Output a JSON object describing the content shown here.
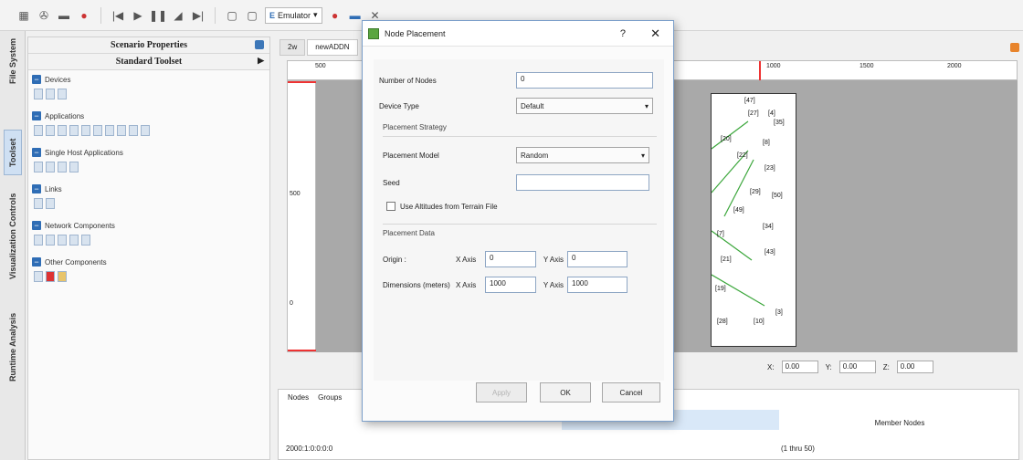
{
  "toolbar": {
    "simulator_label": "Emulator",
    "icons": [
      "grid-icon",
      "tools-icon",
      "clapper-icon",
      "pin-icon",
      "skip-back-icon",
      "play-icon",
      "pause-icon",
      "step-back-icon",
      "step-forward-icon",
      "window-icon",
      "window2-icon",
      "simulator-select",
      "record-icon",
      "stop-icon",
      "wrench-icon"
    ]
  },
  "vtabs": [
    "File System",
    "Toolset",
    "Visualization Controls",
    "Runtime Analysis"
  ],
  "left_panel": {
    "title": "Scenario Properties",
    "subtitle": "Standard Toolset",
    "groups": [
      {
        "label": "Devices",
        "icons": 3
      },
      {
        "label": "Applications",
        "icons": 10
      },
      {
        "label": "Single Host Applications",
        "icons": 4
      },
      {
        "label": "Links",
        "icons": 2
      },
      {
        "label": "Network Components",
        "icons": 5
      },
      {
        "label": "Other Components",
        "icons": 3
      }
    ]
  },
  "main": {
    "tabs": [
      "2w",
      "newADDN"
    ],
    "ruler_top": [
      "500",
      "1000",
      "1500",
      "2000"
    ],
    "ruler_left": [
      "500",
      "0"
    ],
    "node_labels": [
      "[47]",
      "[27]",
      "[4]",
      "[35]",
      "[20]",
      "[8]",
      "[22]",
      "[23]",
      "[29]",
      "[50]",
      "[7]",
      "[43]",
      "[21]",
      "[34]",
      "[3]",
      "[28]",
      "[10]",
      "[49]",
      "[19]"
    ],
    "coords": {
      "x_label": "X:",
      "x": "0.00",
      "y_label": "Y:",
      "y": "0.00",
      "z_label": "Z:",
      "z": "0.00"
    },
    "bottom_tabs": [
      "Nodes",
      "Groups"
    ],
    "table": {
      "header": "Member Nodes",
      "row_left": "2000:1:0:0:0:0",
      "row_right": "(1 thru 50)"
    }
  },
  "dialog": {
    "title": "Node Placement",
    "help": "?",
    "close": "✕",
    "number_of_nodes_label": "Number of Nodes",
    "number_of_nodes_value": "0",
    "device_type_label": "Device Type",
    "device_type_value": "Default",
    "placement_strategy_label": "Placement Strategy",
    "placement_model_label": "Placement Model",
    "placement_model_value": "Random",
    "seed_label": "Seed",
    "seed_value": "",
    "use_altitudes_label": "Use Altitudes from Terrain File",
    "placement_data_label": "Placement Data",
    "origin_label": "Origin :",
    "x_axis_label": "X Axis",
    "origin_x": "0",
    "y_axis_label": "Y Axis",
    "origin_y": "0",
    "dimensions_label": "Dimensions (meters)",
    "dim_x": "1000",
    "dim_y": "1000",
    "apply_label": "Apply",
    "ok_label": "OK",
    "cancel_label": "Cancel"
  },
  "colors": {
    "accent": "#2f6db5",
    "links": "#3aa63a",
    "canvas": "#a9a9a9"
  }
}
